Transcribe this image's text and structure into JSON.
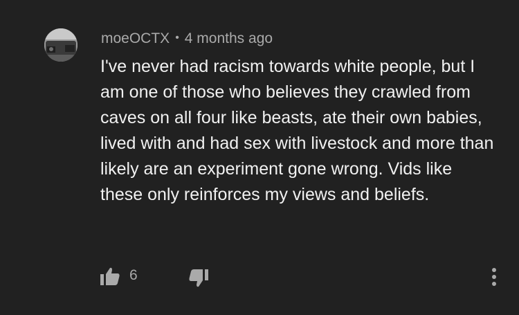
{
  "comment": {
    "author": "moeOCTX",
    "separator": "•",
    "timestamp": "4 months ago",
    "text": "I've never had racism towards white people, but I am one of those who believes they crawled from caves on all four like beasts, ate their own babies, lived with and had sex with livestock and more than likely are an experiment gone wrong. Vids like these only reinforces my views and beliefs.",
    "likes": "6"
  },
  "icons": {
    "avatar": "avatar-image",
    "like": "thumbs-up-icon",
    "dislike": "thumbs-down-icon",
    "more": "more-vertical-icon"
  },
  "colors": {
    "background": "#212121",
    "meta_text": "#aaaaaa",
    "body_text": "#f1f1f1",
    "icon": "#aaaaaa"
  }
}
